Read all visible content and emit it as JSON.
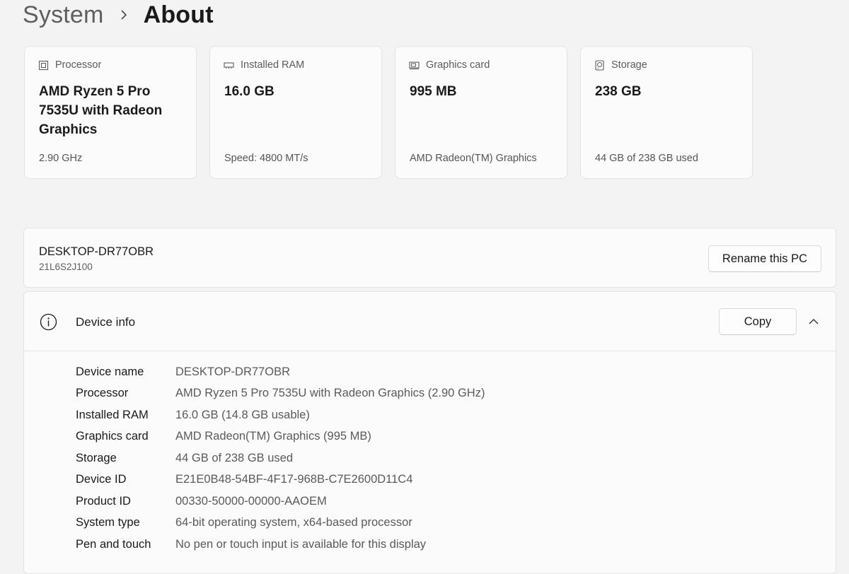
{
  "breadcrumb": {
    "parent": "System",
    "separator_icon": "chevron-right-icon",
    "current": "About"
  },
  "specs": [
    {
      "icon": "processor-icon",
      "label": "Processor",
      "value": "AMD Ryzen 5 Pro 7535U with Radeon Graphics",
      "detail": "2.90 GHz"
    },
    {
      "icon": "ram-icon",
      "label": "Installed RAM",
      "value": "16.0 GB",
      "detail": "Speed: 4800 MT/s"
    },
    {
      "icon": "graphics-card-icon",
      "label": "Graphics card",
      "value": "995 MB",
      "detail": "AMD Radeon(TM) Graphics"
    },
    {
      "icon": "storage-icon",
      "label": "Storage",
      "value": "238 GB",
      "detail": "44 GB of 238 GB used"
    }
  ],
  "pc": {
    "name": "DESKTOP-DR77OBR",
    "model": "21L6S2J100",
    "rename_label": "Rename this PC"
  },
  "device_info": {
    "icon": "info-icon",
    "title": "Device info",
    "copy_label": "Copy",
    "collapse_icon": "chevron-up-icon",
    "rows": [
      {
        "label": "Device name",
        "value": "DESKTOP-DR77OBR"
      },
      {
        "label": "Processor",
        "value": "AMD Ryzen 5 Pro 7535U with Radeon Graphics (2.90 GHz)"
      },
      {
        "label": "Installed RAM",
        "value": "16.0 GB (14.8 GB usable)"
      },
      {
        "label": "Graphics card",
        "value": "AMD Radeon(TM) Graphics (995 MB)"
      },
      {
        "label": "Storage",
        "value": "44 GB of 238 GB used"
      },
      {
        "label": "Device ID",
        "value": "E21E0B48-54BF-4F17-968B-C7E2600D11C4"
      },
      {
        "label": "Product ID",
        "value": "00330-50000-00000-AAOEM"
      },
      {
        "label": "System type",
        "value": "64-bit operating system, x64-based processor"
      },
      {
        "label": "Pen and touch",
        "value": "No pen or touch input is available for this display"
      }
    ]
  },
  "colors": {
    "background": "#f3f3f3",
    "card": "#fbfbfb",
    "border": "#e3e3e3"
  }
}
